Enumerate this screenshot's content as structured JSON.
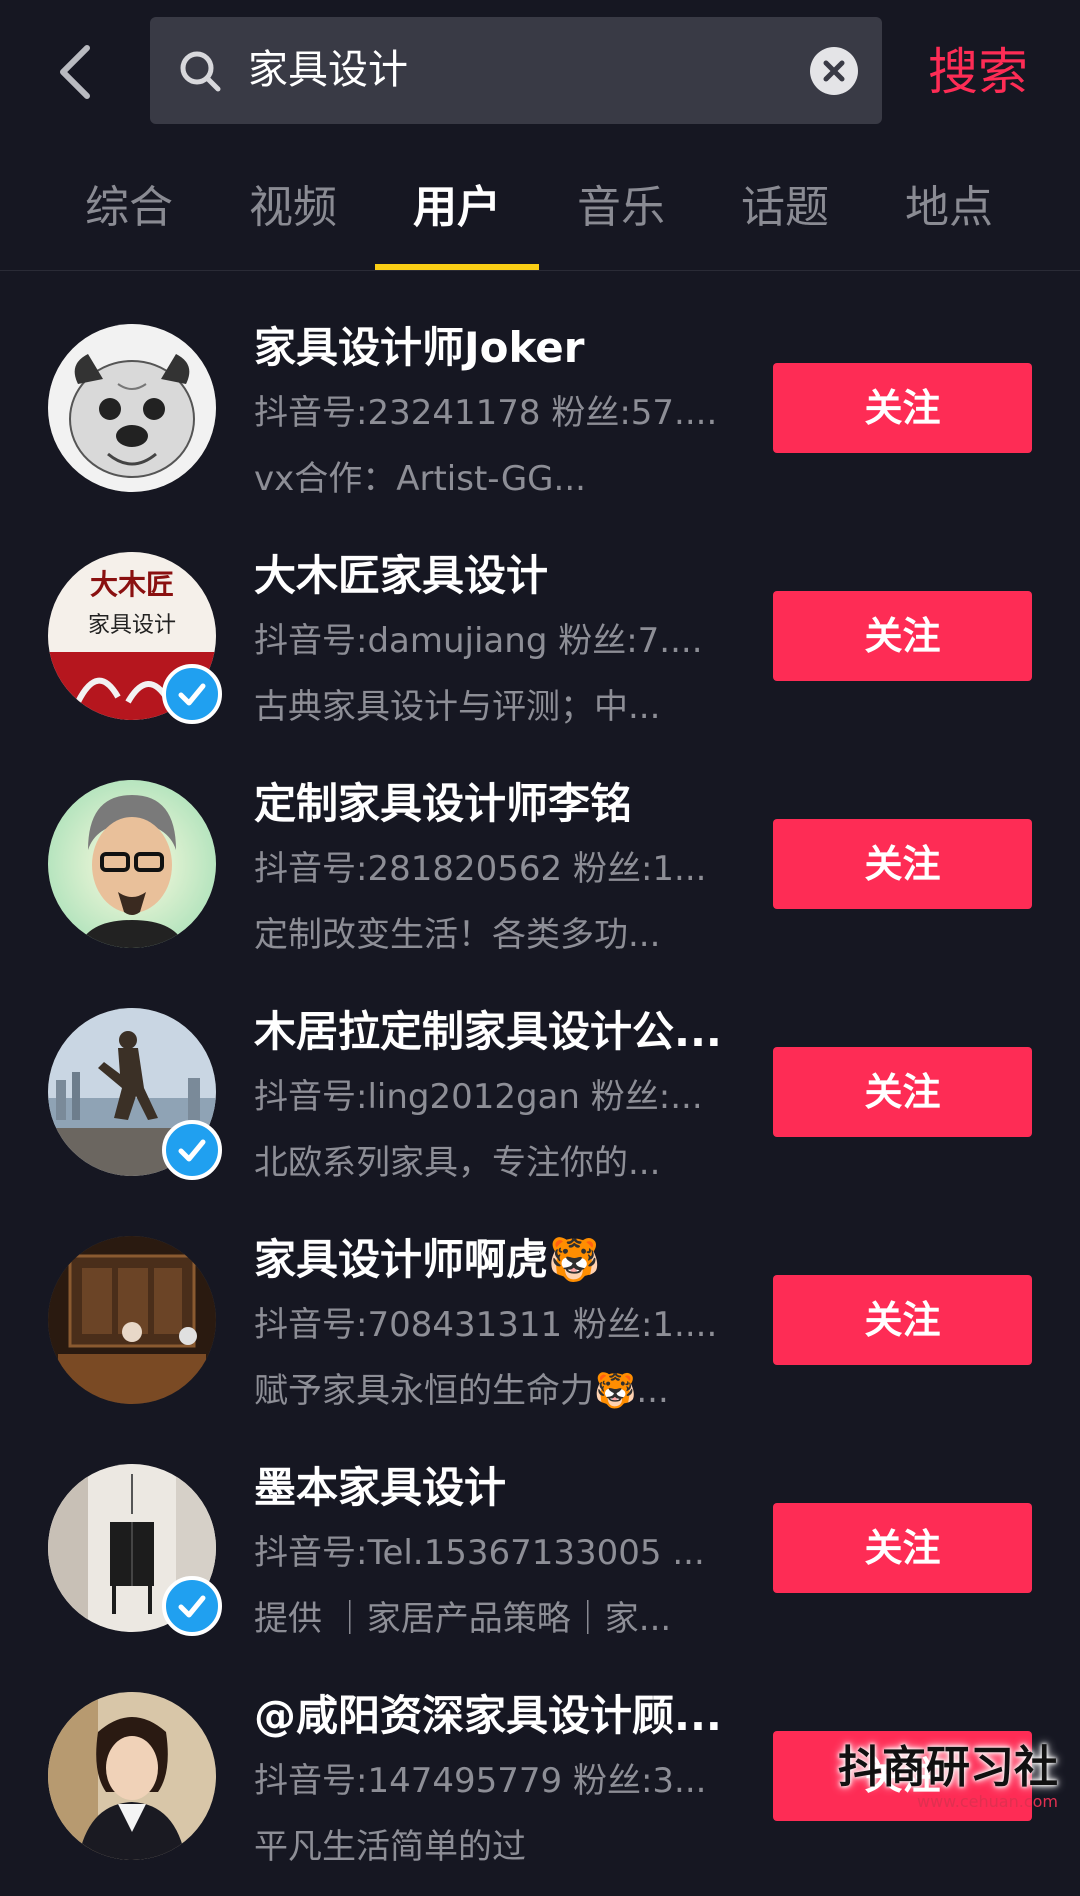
{
  "header": {
    "search_query": "家具设计",
    "search_button": "搜索"
  },
  "tabs": [
    {
      "label": "综合",
      "active": false
    },
    {
      "label": "视频",
      "active": false
    },
    {
      "label": "用户",
      "active": true
    },
    {
      "label": "音乐",
      "active": false
    },
    {
      "label": "话题",
      "active": false
    },
    {
      "label": "地点",
      "active": false
    }
  ],
  "users": [
    {
      "name": "家具设计师Joker",
      "meta": "抖音号:23241178 粉丝:57....",
      "bio": "vx合作：Artist-GG...",
      "verified": false,
      "follow_label": "关注",
      "avatar": "pug-sketch"
    },
    {
      "name": "大木匠家具设计",
      "meta": "抖音号:damujiang 粉丝:7....",
      "bio": "古典家具设计与评测；中...",
      "verified": true,
      "follow_label": "关注",
      "avatar": "calligraphy-logo",
      "avatar_text": [
        "大木匠",
        "家具设计"
      ]
    },
    {
      "name": "定制家具设计师李铭",
      "meta": "抖音号:281820562 粉丝:1...",
      "bio": "定制改变生活！各类多功...",
      "verified": false,
      "follow_label": "关注",
      "avatar": "cartoon-man"
    },
    {
      "name": "木居拉定制家具设计公...",
      "meta": "抖音号:ling2012gan 粉丝:...",
      "bio": "北欧系列家具，专注你的...",
      "verified": true,
      "follow_label": "关注",
      "avatar": "statue-photo"
    },
    {
      "name": "家具设计师啊虎🐯",
      "meta": "抖音号:708431311 粉丝:1....",
      "bio": "赋予家具永恒的生命力🐯...",
      "verified": false,
      "follow_label": "关注",
      "avatar": "wood-room"
    },
    {
      "name": "墨本家具设计",
      "meta": "抖音号:Tel.15367133005 ...",
      "bio": "提供 ｜家居产品策略｜家...",
      "verified": true,
      "follow_label": "关注",
      "avatar": "interior-cabinet"
    },
    {
      "name": "@咸阳资深家具设计顾...",
      "meta": "抖音号:147495779 粉丝:3...",
      "bio": "平凡生活简单的过",
      "verified": false,
      "follow_label": "关注",
      "avatar": "woman-portrait"
    }
  ],
  "watermark": {
    "main": "抖商研习社",
    "sub": "www.cehuan.com"
  }
}
